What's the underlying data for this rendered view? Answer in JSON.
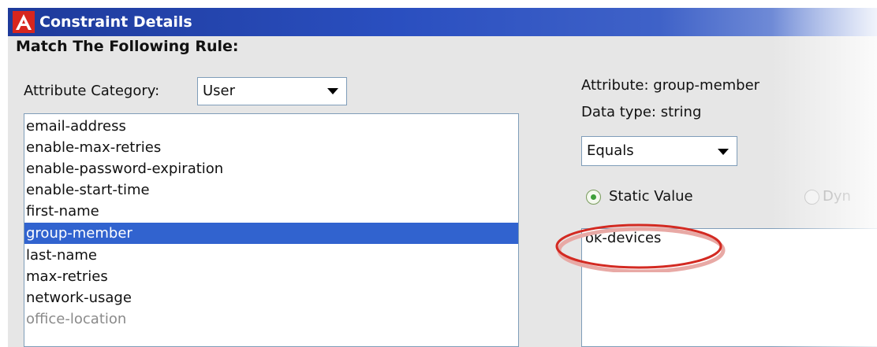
{
  "window": {
    "title": "Constraint Details",
    "logo_letter": "A",
    "colors": {
      "titlebar": "#2a4fc0",
      "logo": "#d7261e",
      "selection": "#3163cf",
      "annotation": "#d32a22"
    }
  },
  "rule": {
    "heading": "Match The Following Rule:"
  },
  "category": {
    "label": "Attribute Category:",
    "selected": "User"
  },
  "attributes": {
    "items": [
      "email-address",
      "enable-max-retries",
      "enable-password-expiration",
      "enable-start-time",
      "first-name",
      "group-member",
      "last-name",
      "max-retries",
      "network-usage",
      "office-location"
    ],
    "selected_index": 5
  },
  "details": {
    "attribute_text": "Attribute: group-member",
    "data_type_text": "Data type: string",
    "operator": "Equals",
    "static_value_label": "Static Value",
    "dynamic_value_label": "Dyn",
    "value_selected": "static",
    "value": "ok-devices"
  },
  "icons": {
    "logo": "app-logo-icon",
    "dropdown": "chevron-down-icon",
    "annotation": "highlight-ellipse"
  }
}
